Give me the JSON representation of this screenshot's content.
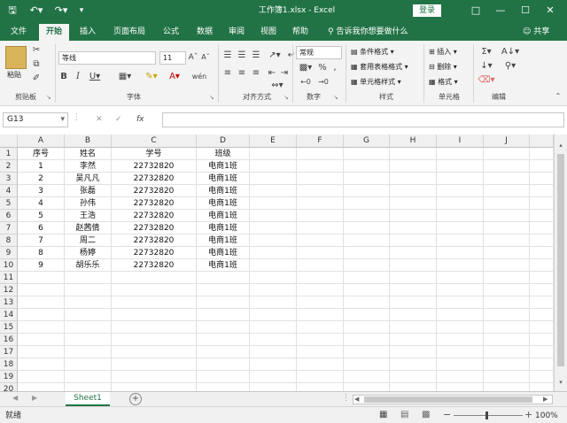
{
  "app": {
    "title": "工作簿1.xlsx  -  Excel",
    "login_label": "登录",
    "brand_color": "#217346"
  },
  "quick_access": {
    "save_icon": "save-icon",
    "undo_icon": "undo-icon",
    "redo_icon": "redo-icon"
  },
  "tabs": [
    {
      "label": "文件"
    },
    {
      "label": "开始",
      "active": true
    },
    {
      "label": "插入"
    },
    {
      "label": "页面布局"
    },
    {
      "label": "公式"
    },
    {
      "label": "数据"
    },
    {
      "label": "审阅"
    },
    {
      "label": "视图"
    },
    {
      "label": "帮助"
    }
  ],
  "tell_me": "告诉我你想要做什么",
  "share_label": "共享",
  "ribbon": {
    "clipboard": {
      "paste_label": "粘贴",
      "group_label": "剪贴板"
    },
    "font": {
      "name": "等线",
      "size": "11",
      "group_label": "字体"
    },
    "alignment": {
      "group_label": "对齐方式"
    },
    "number": {
      "format": "常规",
      "percent": "%",
      "comma": ",",
      "group_label": "数字"
    },
    "styles": {
      "conditional": "条件格式",
      "table": "套用表格格式",
      "cell_styles": "单元格样式",
      "group_label": "样式"
    },
    "cells": {
      "insert": "插入",
      "delete": "删除",
      "format": "格式",
      "group_label": "单元格"
    },
    "editing": {
      "group_label": "编辑"
    }
  },
  "formula_bar": {
    "name_box": "G13",
    "formula": "",
    "fx_label": "fx"
  },
  "columns": [
    "A",
    "B",
    "C",
    "D",
    "E",
    "F",
    "G",
    "H",
    "I",
    "J"
  ],
  "rows": [
    "1",
    "2",
    "3",
    "4",
    "5",
    "6",
    "7",
    "8",
    "9",
    "10",
    "11",
    "12",
    "13",
    "14",
    "15",
    "16",
    "17",
    "18",
    "19",
    "20"
  ],
  "cells": [
    [
      "序号",
      "姓名",
      "学号",
      "班级"
    ],
    [
      "1",
      "李然",
      "22732820",
      "电商1班"
    ],
    [
      "2",
      "吴凡凡",
      "22732820",
      "电商1班"
    ],
    [
      "3",
      "张磊",
      "22732820",
      "电商1班"
    ],
    [
      "4",
      "孙伟",
      "22732820",
      "电商1班"
    ],
    [
      "5",
      "王浩",
      "22732820",
      "电商1班"
    ],
    [
      "6",
      "赵茜倩",
      "22732820",
      "电商1班"
    ],
    [
      "7",
      "周二",
      "22732820",
      "电商1班"
    ],
    [
      "8",
      "杨婷",
      "22732820",
      "电商1班"
    ],
    [
      "9",
      "胡乐乐",
      "22732820",
      "电商1班"
    ]
  ],
  "sheet_tab": "Sheet1",
  "status": "就绪",
  "zoom": "100%"
}
